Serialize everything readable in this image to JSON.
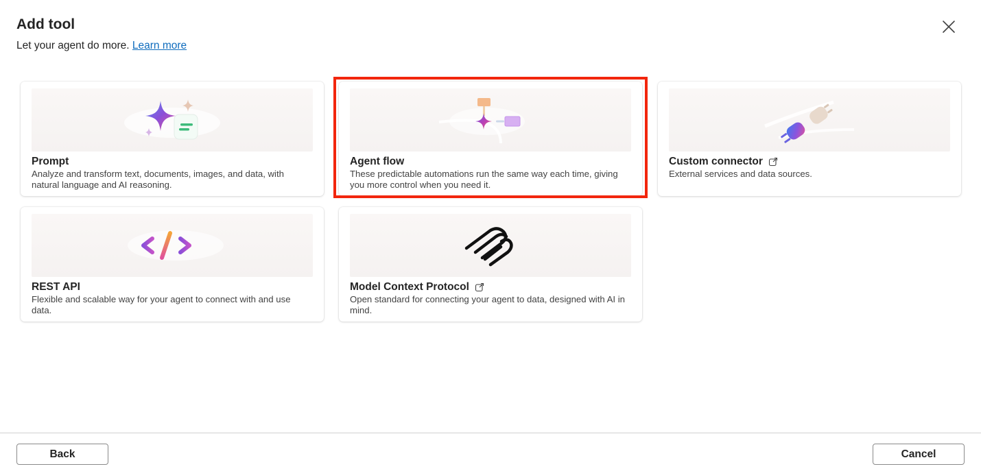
{
  "dialog": {
    "title": "Add tool",
    "subtitle": "Let your agent do more.",
    "learn_more_label": "Learn more",
    "close_icon": "close-icon"
  },
  "cards": [
    {
      "title": "Prompt",
      "description": "Analyze and transform text, documents, images, and data, with natural language and AI reasoning.",
      "icon": "prompt-sparkle-icon",
      "external": false,
      "selected": false
    },
    {
      "title": "Agent flow",
      "description": "These predictable automations run the same way each time, giving you more control when you need it.",
      "icon": "agent-flow-icon",
      "external": false,
      "selected": true
    },
    {
      "title": "Custom connector",
      "description": "External services and data sources.",
      "icon": "plug-connector-icon",
      "external": true,
      "selected": false
    },
    {
      "title": "REST API",
      "description": "Flexible and scalable way for your agent to connect with and use data.",
      "icon": "code-brackets-icon",
      "external": false,
      "selected": false
    },
    {
      "title": "Model Context Protocol",
      "description": "Open standard for connecting your agent to data, designed with AI in mind.",
      "icon": "mcp-logo-icon",
      "external": true,
      "selected": false
    }
  ],
  "footer": {
    "back_label": "Back",
    "cancel_label": "Cancel"
  },
  "colors": {
    "link": "#0f6cbd",
    "highlight": "#f2260d",
    "text": "#242424"
  }
}
